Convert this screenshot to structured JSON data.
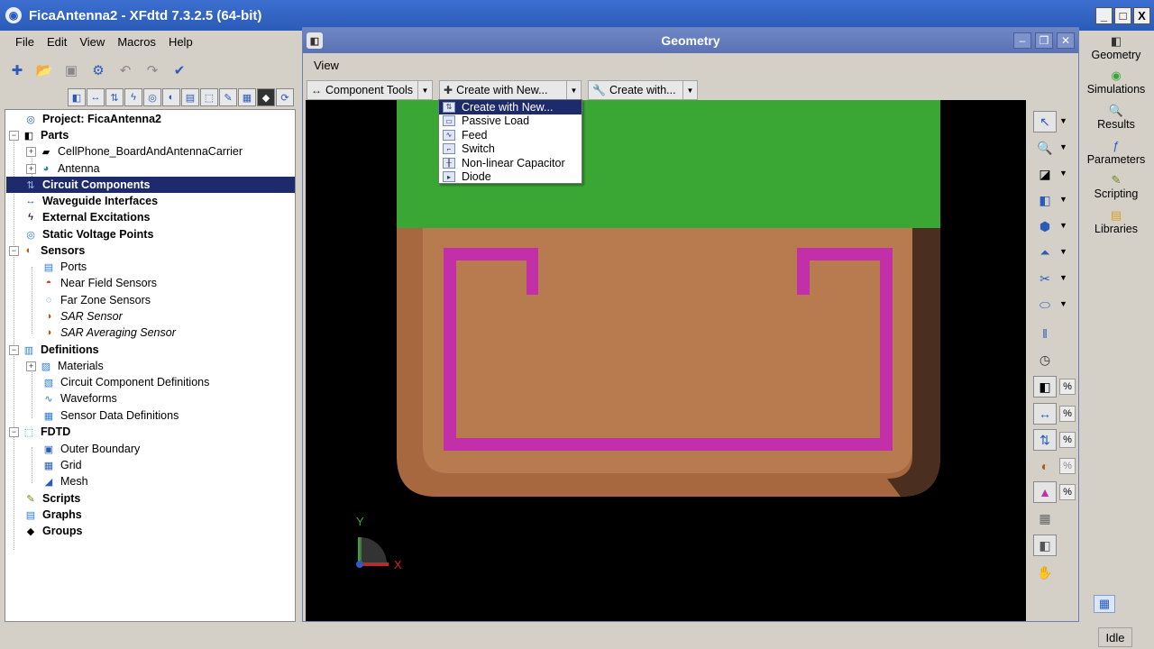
{
  "window": {
    "title": "FicaAntenna2 - XFdtd 7.3.2.5 (64-bit)",
    "min": "_",
    "max": "□",
    "close": "X"
  },
  "menu": [
    "File",
    "Edit",
    "View",
    "Macros",
    "Help"
  ],
  "tree": {
    "project": "Project: FicaAntenna2",
    "parts": "Parts",
    "part1": "CellPhone_BoardAndAntennaCarrier",
    "part2": "Antenna",
    "circuit": "Circuit Components",
    "waveguide": "Waveguide Interfaces",
    "excitations": "External Excitations",
    "voltage": "Static Voltage Points",
    "sensors": "Sensors",
    "ports": "Ports",
    "nearfield": "Near Field Sensors",
    "farzone": "Far Zone Sensors",
    "sar": "SAR Sensor",
    "saravg": "SAR Averaging Sensor",
    "definitions": "Definitions",
    "materials": "Materials",
    "ccdefs": "Circuit Component Definitions",
    "waveforms": "Waveforms",
    "sensordata": "Sensor Data Definitions",
    "fdtd": "FDTD",
    "outer": "Outer Boundary",
    "grid": "Grid",
    "mesh": "Mesh",
    "scripts": "Scripts",
    "graphs": "Graphs",
    "groups": "Groups"
  },
  "geometry": {
    "title": "Geometry",
    "menu_view": "View",
    "component_tools": "Component Tools",
    "create_with_new": "Create with New...",
    "create_with": "Create with...",
    "axis_x": "X",
    "axis_y": "Y"
  },
  "dropdown": [
    "Create with New...",
    "Passive Load",
    "Feed",
    "Switch",
    "Non-linear Capacitor",
    "Diode"
  ],
  "side": [
    "Geometry",
    "Simulations",
    "Results",
    "Parameters",
    "Scripting",
    "Libraries"
  ],
  "status": "Idle",
  "colors": {
    "ground": "#3aa734",
    "substrate": "#b87a4f",
    "antenna": "#c22fa8",
    "selection": "#1d2a6b"
  }
}
